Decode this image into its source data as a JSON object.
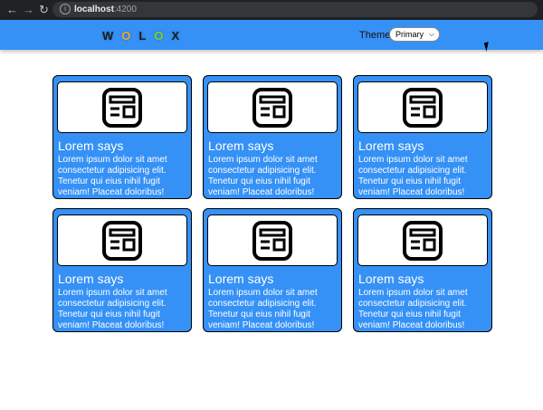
{
  "browser": {
    "nav": {
      "back": "←",
      "forward": "→",
      "reload": "↻"
    },
    "url": {
      "host": "localhost",
      "port": ":4200"
    }
  },
  "header": {
    "logo": {
      "letters": [
        "W",
        "O",
        "L",
        "O",
        "X"
      ],
      "colors": [
        "#1a1a1a",
        "#f5a623",
        "#1a1a1a",
        "#7ed321",
        "#1a1a1a"
      ]
    },
    "theme_label": "Theme",
    "theme_select": {
      "value": "Primary"
    }
  },
  "cards": [
    {
      "icon": "news-icon",
      "title": "Lorem says",
      "text": "Lorem ipsum dolor sit amet consectetur adipisicing elit. Tenetur qui eius nihil fugit veniam! Placeat doloribus!"
    },
    {
      "icon": "news-icon",
      "title": "Lorem says",
      "text": "Lorem ipsum dolor sit amet consectetur adipisicing elit. Tenetur qui eius nihil fugit veniam! Placeat doloribus!"
    },
    {
      "icon": "news-icon",
      "title": "Lorem says",
      "text": "Lorem ipsum dolor sit amet consectetur adipisicing elit. Tenetur qui eius nihil fugit veniam! Placeat doloribus!"
    },
    {
      "icon": "news-icon",
      "title": "Lorem says",
      "text": "Lorem ipsum dolor sit amet consectetur adipisicing elit. Tenetur qui eius nihil fugit veniam! Placeat doloribus!"
    },
    {
      "icon": "news-icon",
      "title": "Lorem says",
      "text": "Lorem ipsum dolor sit amet consectetur adipisicing elit. Tenetur qui eius nihil fugit veniam! Placeat doloribus!"
    },
    {
      "icon": "news-icon",
      "title": "Lorem says",
      "text": "Lorem ipsum dolor sit amet consectetur adipisicing elit. Tenetur qui eius nihil fugit veniam! Placeat doloribus!"
    }
  ],
  "colors": {
    "primary": "#3591f6",
    "card_border": "#000000",
    "text_on_primary": "#ffffff"
  }
}
